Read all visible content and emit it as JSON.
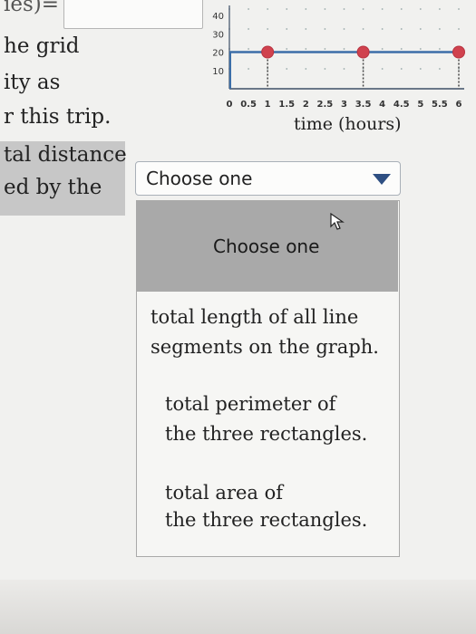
{
  "question": {
    "line0": "ies)=",
    "line1": "he grid",
    "line2": "ity as",
    "line3": "r this trip.",
    "line4": "tal distance",
    "line5": "ed by the"
  },
  "graph": {
    "y_ticks": [
      "40",
      "30",
      "20",
      "10"
    ],
    "x_ticks": [
      "0",
      "0.5",
      "1",
      "1.5",
      "2",
      "2.5",
      "3",
      "3.5",
      "4",
      "4.5",
      "5",
      "5.5",
      "6"
    ],
    "x_label": "time (hours)",
    "line_color": "#3c6ea8",
    "point_color": "#d0424e"
  },
  "dropdown": {
    "selected": "Choose one",
    "options": [
      {
        "label": "Choose one",
        "lines": [
          "Choose one"
        ]
      },
      {
        "label": "total length of all line segments on the graph.",
        "lines": [
          "total length of all line",
          "segments on the graph."
        ]
      },
      {
        "label": "total perimeter of the three rectangles.",
        "lines": [
          "total perimeter of",
          "the three rectangles."
        ]
      },
      {
        "label": "total area of the three rectangles.",
        "lines": [
          "total area of",
          "the three rectangles."
        ]
      }
    ]
  },
  "icons": {
    "arrow": "caret-down-icon",
    "cursor": "mouse-pointer-icon"
  }
}
